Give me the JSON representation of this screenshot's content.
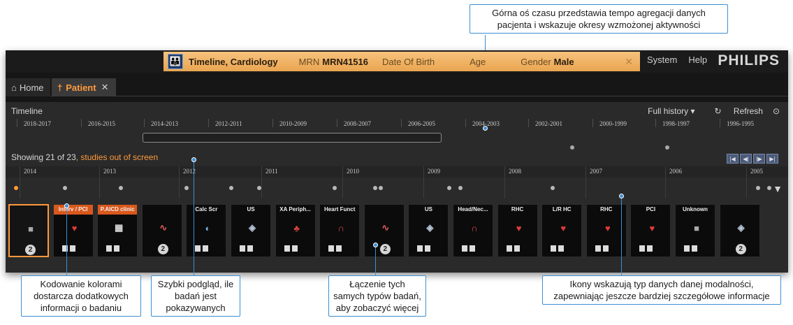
{
  "callouts": {
    "top_right": "Górna oś czasu przedstawia tempo agregacji danych pacjenta i wskazuje okresy wzmożonej aktywności",
    "color_coding": "Kodowanie kolorami dostarcza dodatkowych informacji o badaniu",
    "quick_view": "Szybki podgląd, ile badań jest pokazywanych",
    "grouping": "Łączenie tych samych typów badań, aby zobaczyć więcej",
    "icons": "Ikony wskazują typ danych danej modalności, zapewniając jeszcze bardziej szczegółowe informacje"
  },
  "header": {
    "banner_title": "Timeline, Cardiology",
    "mrn_label": "MRN",
    "mrn_value": "MRN41516",
    "dob_label": "Date Of Birth",
    "age_label": "Age",
    "gender_label": "Gender",
    "gender_value": "Male",
    "nav": [
      "System",
      "Help"
    ],
    "logo": "PHILIPS"
  },
  "tabs": {
    "home": "Home",
    "patient": "Patient"
  },
  "panel": {
    "title": "Timeline",
    "full_history": "Full history",
    "refresh": "Refresh",
    "showing": "Showing 21 of 23",
    "studies_out": ", studies out of screen"
  },
  "upper_axis": [
    "2018-2017",
    "2016-2015",
    "2014-2013",
    "2012-2011",
    "2010-2009",
    "2008-2007",
    "2006-2005",
    "2004-2003",
    "2002-2001",
    "2000-1999",
    "1998-1997",
    "1996-1995"
  ],
  "lower_axis": [
    "2014",
    "2013",
    "2012",
    "2011",
    "2010",
    "2009",
    "2008",
    "2007",
    "2006",
    "2005"
  ],
  "cards": [
    {
      "tag": "",
      "icon": "cube-icon",
      "count": "2",
      "tag_color": "none"
    },
    {
      "tag": "Interv / PCI",
      "icon": "heart-catheter-icon",
      "count": "",
      "tag_color": "orange"
    },
    {
      "tag": "P.AICD clinic",
      "icon": "building-icon",
      "count": "",
      "tag_color": "orange"
    },
    {
      "tag": "",
      "icon": "ecg-icon",
      "count": "2",
      "tag_color": "none"
    },
    {
      "tag": "Calc Scr",
      "icon": "ct-scanner-icon",
      "count": "",
      "tag_color": "none"
    },
    {
      "tag": "US",
      "icon": "ultrasound-icon",
      "count": "",
      "tag_color": "none"
    },
    {
      "tag": "XA Periph...",
      "icon": "xa-icon",
      "count": "",
      "tag_color": "none"
    },
    {
      "tag": "Heart Funct",
      "icon": "magnet-icon",
      "count": "",
      "tag_color": "none"
    },
    {
      "tag": "",
      "icon": "ecg-icon",
      "count": "2",
      "tag_color": "none"
    },
    {
      "tag": "US",
      "icon": "ultrasound-icon",
      "count": "",
      "tag_color": "none"
    },
    {
      "tag": "Head/Nec...",
      "icon": "magnet-icon",
      "count": "",
      "tag_color": "none"
    },
    {
      "tag": "RHC",
      "icon": "heart-catheter-icon",
      "count": "",
      "tag_color": "none"
    },
    {
      "tag": "L/R HC",
      "icon": "heart-catheter-icon",
      "count": "",
      "tag_color": "none"
    },
    {
      "tag": "RHC",
      "icon": "heart-catheter-icon",
      "count": "",
      "tag_color": "none"
    },
    {
      "tag": "PCI",
      "icon": "heart-catheter-icon",
      "count": "",
      "tag_color": "none"
    },
    {
      "tag": "Unknown",
      "icon": "cube-icon",
      "count": "",
      "tag_color": "none"
    },
    {
      "tag": "",
      "icon": "ultrasound-icon",
      "count": "2",
      "tag_color": "none"
    }
  ],
  "colors": {
    "accent_orange": "#ff9a3c",
    "banner": "#f2b466",
    "callout_blue": "#3b8fd4",
    "card_tag_orange": "#d9581c"
  }
}
